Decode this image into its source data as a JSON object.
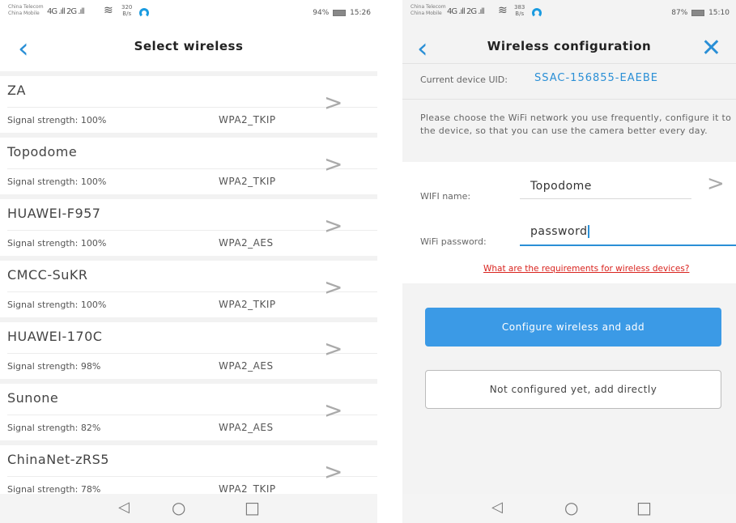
{
  "left": {
    "status": {
      "carrier_top": "China Telecom",
      "carrier_bottom": "China Mobile",
      "signal": "4G .ıll 2G .ıll",
      "wifi": "≋",
      "speed_value": "320",
      "speed_unit": "B/s",
      "battery_text": "94%",
      "time": "15:26"
    },
    "header": {
      "title": "Select wireless",
      "back_icon": "‹"
    },
    "networks": [
      {
        "ssid": "ZA",
        "strength": "Signal strength: 100%",
        "encryption": "WPA2_TKIP"
      },
      {
        "ssid": "Topodome",
        "strength": "Signal strength: 100%",
        "encryption": "WPA2_TKIP"
      },
      {
        "ssid": "HUAWEI-F957",
        "strength": "Signal strength: 100%",
        "encryption": "WPA2_AES"
      },
      {
        "ssid": "CMCC-SuKR",
        "strength": "Signal strength: 100%",
        "encryption": "WPA2_TKIP"
      },
      {
        "ssid": "HUAWEI-170C",
        "strength": "Signal strength: 98%",
        "encryption": "WPA2_AES"
      },
      {
        "ssid": "Sunone",
        "strength": "Signal strength: 82%",
        "encryption": "WPA2_AES"
      },
      {
        "ssid": "ChinaNet-zRS5",
        "strength": "Signal strength: 78%",
        "encryption": "WPA2_TKIP"
      }
    ]
  },
  "right": {
    "status": {
      "carrier_top": "China Telecom",
      "carrier_bottom": "China Mobile",
      "signal": "4G .ıll 2G .ıll",
      "wifi": "≋",
      "speed_value": "383",
      "speed_unit": "B/s",
      "battery_text": "87%",
      "time": "15:10"
    },
    "header": {
      "title": "Wireless configuration",
      "back_icon": "‹",
      "close_icon": "✕"
    },
    "uid_label": "Current device UID:",
    "uid_value": "SSAC-156855-EAEBE",
    "description": "Please choose the WiFi network you use frequently, configure it to the device, so that you can use the camera better every day.",
    "wifi_name_label": "WIFI name:",
    "wifi_name_value": "Topodome",
    "wifi_password_label": "WiFi password:",
    "wifi_password_value": "password",
    "requirements_link": "What are the requirements for wireless devices?",
    "configure_button": "Configure wireless and add",
    "add_directly_button": "Not configured yet, add directly"
  },
  "nav_icons": {
    "back": "◁",
    "home": "○",
    "recents": "□"
  },
  "colors": {
    "accent": "#2a8fd6",
    "primary_button": "#3b9ae6",
    "link_red": "#d9231e"
  }
}
